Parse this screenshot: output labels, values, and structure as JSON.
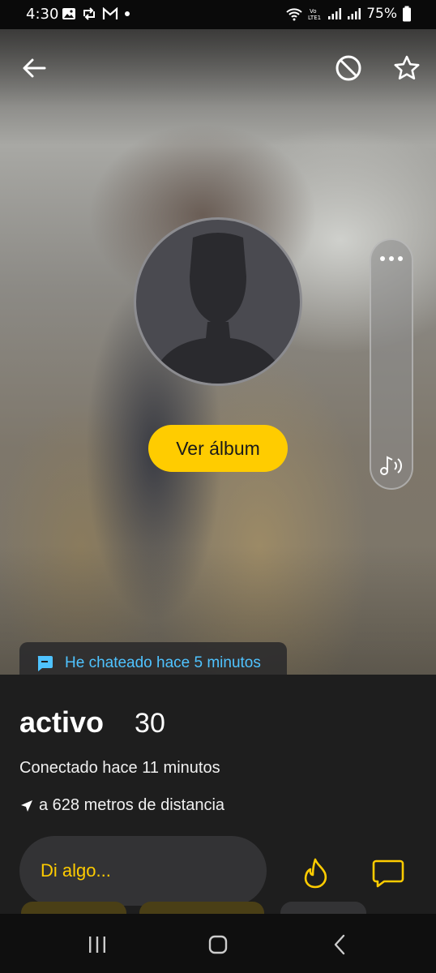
{
  "status_bar": {
    "time": "4:30",
    "battery": "75%",
    "left_icons": [
      "image-icon",
      "sync-icon",
      "gmail-icon",
      "dot-icon"
    ],
    "right_icons": [
      "wifi-icon",
      "volte-icon",
      "signal-icon",
      "signal-icon",
      "battery-icon"
    ]
  },
  "header": {
    "back_icon": "arrow-left-icon",
    "block_icon": "block-icon",
    "favorite_icon": "star-icon"
  },
  "profile": {
    "album_button": "Ver álbum",
    "chat_status": "He chateado hace 5 minutos",
    "name": "activo",
    "age": "30",
    "online_status": "Conectado hace 11 minutos",
    "distance": "a 628 metros de distancia"
  },
  "side_panel": {
    "more_icon": "more-horizontal-icon",
    "audio_icon": "audio-icon"
  },
  "compose": {
    "placeholder": "Di algo...",
    "fire_icon": "flame-icon",
    "message_icon": "message-icon"
  },
  "colors": {
    "accent": "#ffcc00",
    "chat_status": "#4fc3ff",
    "background": "#1e1e1e"
  },
  "nav_bar": {
    "icons": [
      "recents-icon",
      "home-icon",
      "back-icon"
    ]
  }
}
